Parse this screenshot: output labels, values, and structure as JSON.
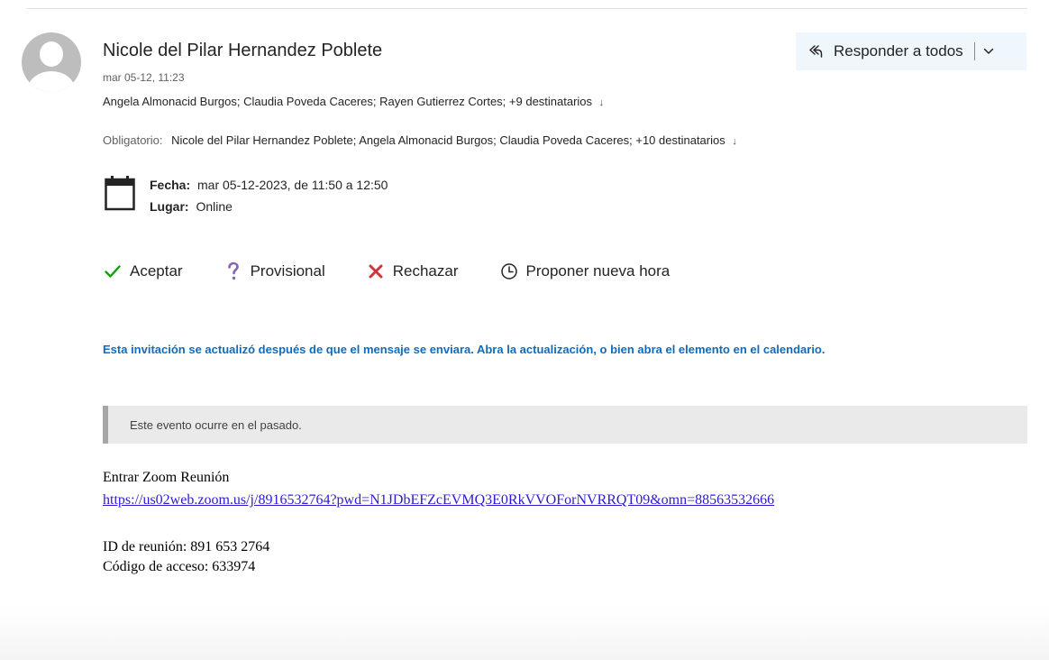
{
  "sender": {
    "name": "Nicole del Pilar Hernandez Poblete",
    "sent_time": "mar 05-12, 11:23",
    "avatar_icon": "person-icon"
  },
  "recipients": {
    "to_text": "Angela Almonacid Burgos; Claudia Poveda Caceres; Rayen Gutierrez Cortes; +9 destinatarios",
    "required_label": "Obligatorio:",
    "required_text": "Nicole del Pilar Hernandez Poblete; Angela Almonacid Burgos; Claudia Poveda Caceres; +10 destinatarios",
    "expand_glyph": "»"
  },
  "reply_all": {
    "label": "Responder a todos",
    "icon": "reply-all-icon",
    "dropdown_icon": "chevron-down-icon",
    "background": "#eff6fc"
  },
  "meeting": {
    "date_label": "Fecha:",
    "date_value": "mar 05-12-2023, de 11:50 a 12:50",
    "location_label": "Lugar:",
    "location_value": "Online"
  },
  "responses": {
    "accept": {
      "label": "Aceptar",
      "icon": "checkmark-icon",
      "color": "#13a10e"
    },
    "tentative": {
      "label": "Provisional",
      "icon": "question-icon",
      "color": "#8764b8"
    },
    "decline": {
      "label": "Rechazar",
      "icon": "x-icon",
      "color": "#d13438"
    },
    "propose": {
      "label": "Proponer nueva hora",
      "icon": "clock-icon",
      "color": "#242424"
    }
  },
  "update_notice": "Esta invitación se actualizó después de que el mensaje se enviara. Abra la actualización, o bien abra el elemento en el calendario.",
  "past_banner": "Este evento ocurre en el pasado.",
  "body": {
    "join_label": "Entrar Zoom Reunión",
    "join_url": "https://us02web.zoom.us/j/8916532764?pwd=N1JDbEFZcEVMQ3E0RkVVOForNVRRQT09&omn=88563532666",
    "meeting_id": "ID de reunión: 891 653 2764",
    "passcode": "Código de acceso: 633974"
  },
  "colors": {
    "link": "#2c1bd0",
    "notice": "#0f6cbd",
    "banner_bg": "#eaeaea"
  }
}
